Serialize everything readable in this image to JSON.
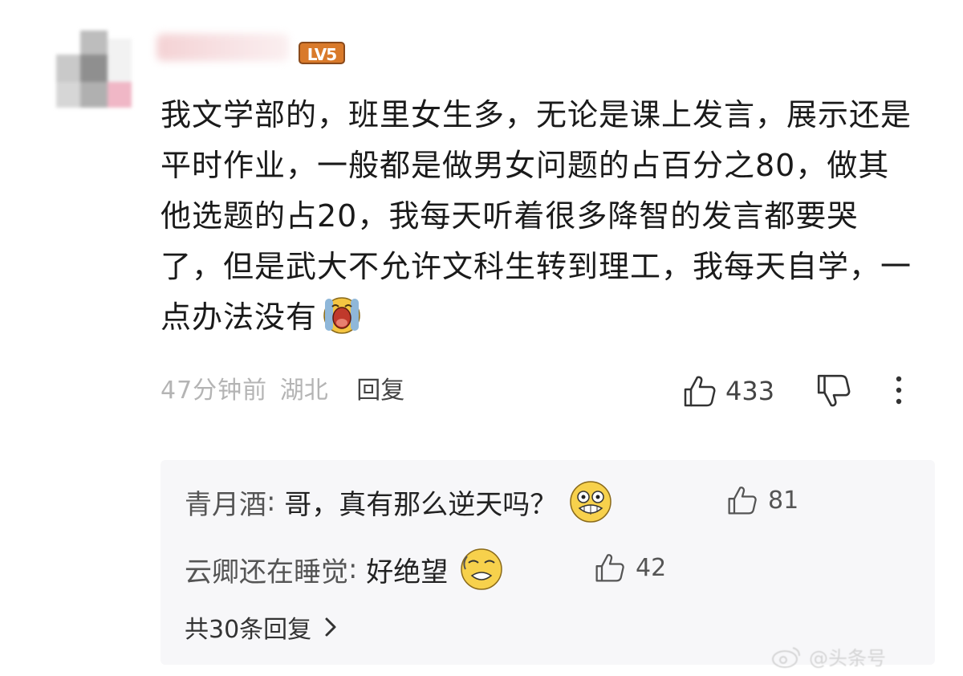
{
  "comment": {
    "level_badge": "LV5",
    "text": "我文学部的，班里女生多，无论是课上发言，展示还是平时作业，一般都是做男女问题的占百分之80，做其他选题的占20，我每天听着很多降智的发言都要哭了，但是武大不允许文科生转到理工，我每天自学，一点办法没有",
    "emoji": "crying-emoji",
    "time": "47分钟前",
    "location": "湖北",
    "reply_label": "回复",
    "like_count": "433",
    "colors": {
      "badge": "#d97a2b",
      "meta": "#b4b4b4",
      "text": "#1a1a1a"
    }
  },
  "replies": {
    "items": [
      {
        "author": "青月酒",
        "text": "哥，真有那么逆天吗？",
        "emoji": "shocked-emoji",
        "like_count": "81"
      },
      {
        "author": "云卿还在睡觉",
        "text": "好绝望",
        "emoji": "despair-emoji",
        "like_count": "42"
      }
    ],
    "total_label": "共30条回复",
    "panel_color": "#f7f7f9"
  },
  "watermark": {
    "text": "@头条号"
  }
}
